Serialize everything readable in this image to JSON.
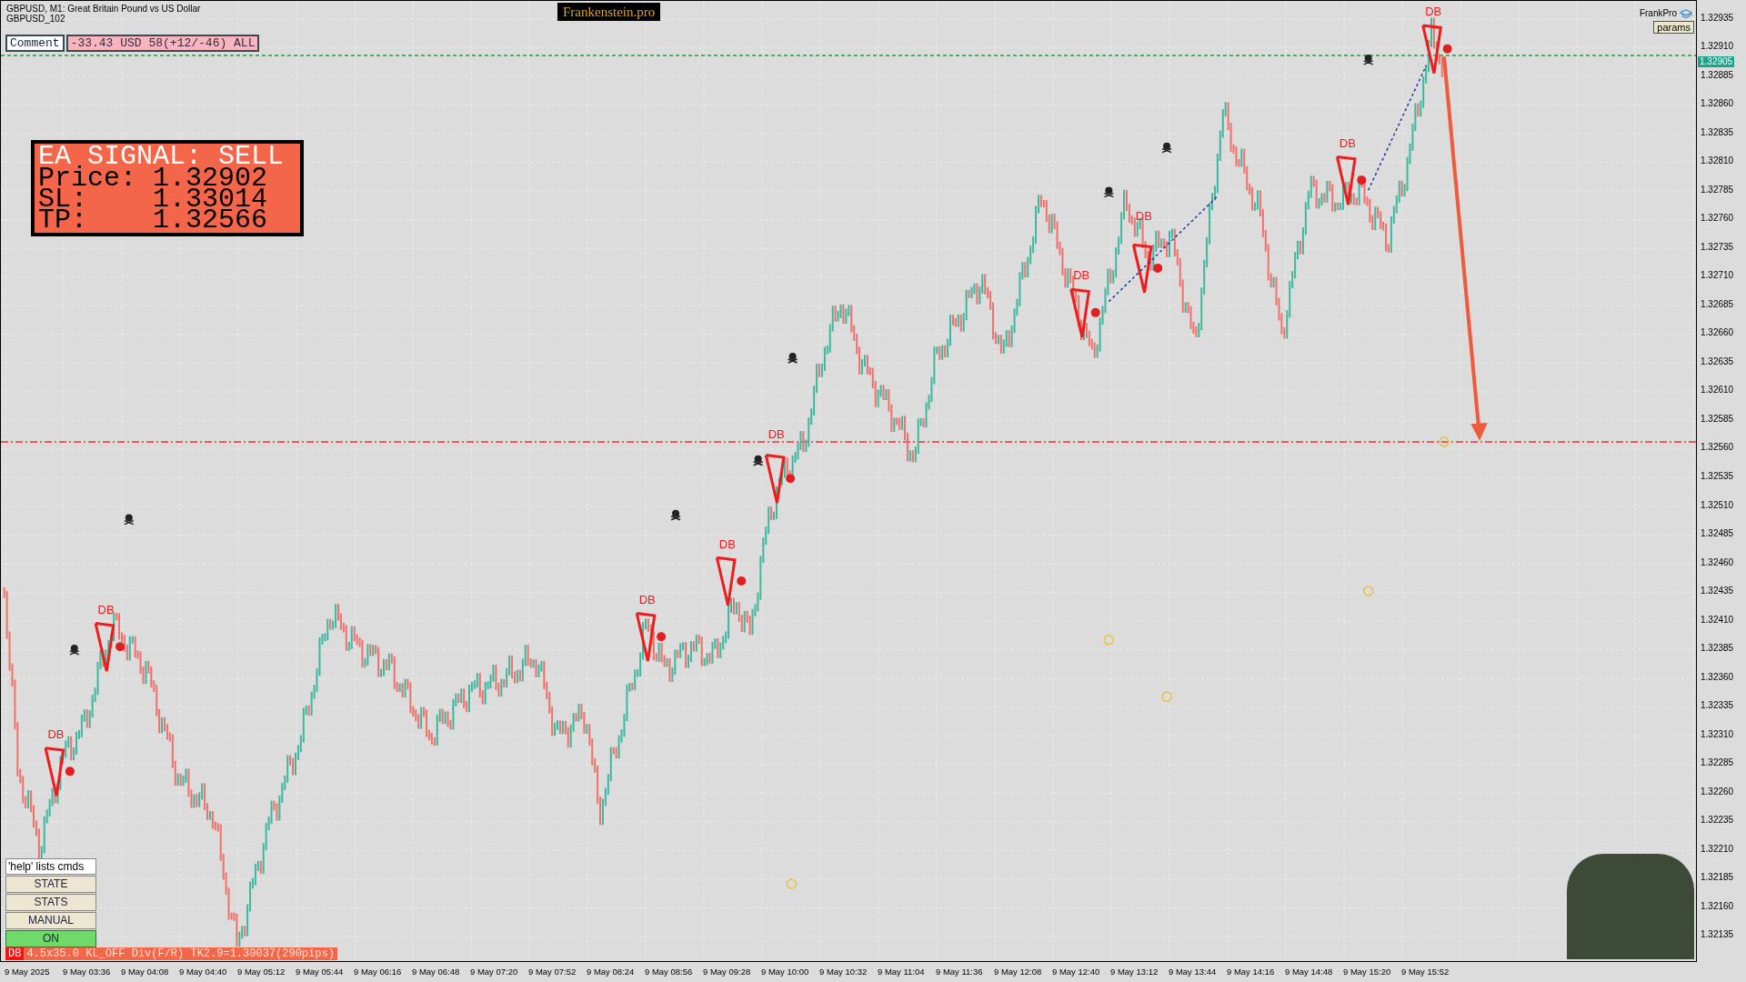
{
  "chart": {
    "symbol_line": "GBPUSD, M1:  Great Britain Pound vs US Dollar",
    "sub_line": "GBPUSD_102"
  },
  "comment": {
    "label": "Comment",
    "value": "-33.43 USD 58(+12/-46) ALL"
  },
  "brand": "Frankenstein.pro",
  "indicator": {
    "name": "FrankPro",
    "button": "params"
  },
  "signal_panel": {
    "title": "EA SIGNAL: SELL",
    "rows": [
      {
        "label": "Price:",
        "value": "1.32902"
      },
      {
        "label": "SL:",
        "value": "1.33014"
      },
      {
        "label": "TP:",
        "value": "1.32566"
      }
    ]
  },
  "pattern_labels": [
    "DB",
    "DB",
    "DB",
    "DB",
    "DB",
    "DB",
    "DB",
    "DB",
    "DB"
  ],
  "controls": {
    "hint": "'help' lists cmds",
    "buttons": [
      {
        "label": "STATE",
        "kind": "plain"
      },
      {
        "label": "STATS",
        "kind": "plain"
      },
      {
        "label": "MANUAL",
        "kind": "plain"
      },
      {
        "label": "ON",
        "kind": "toggle",
        "on": true
      }
    ]
  },
  "status_bar": {
    "tag": "DB",
    "text": "4.5x35.0 KL_OFF Div(F/R) TK2.9=1.30037(290pips)"
  },
  "price_axis": {
    "labels": [
      "1.32935",
      "1.32910",
      "1.32885",
      "1.32860",
      "1.32835",
      "1.32810",
      "1.32785",
      "1.32760",
      "1.32735",
      "1.32710",
      "1.32685",
      "1.32660",
      "1.32635",
      "1.32610",
      "1.32585",
      "1.32560",
      "1.32535",
      "1.32510",
      "1.32485",
      "1.32460",
      "1.32435",
      "1.32410",
      "1.32385",
      "1.32360",
      "1.32335",
      "1.32310",
      "1.32285",
      "1.32260",
      "1.32235",
      "1.32210",
      "1.32185",
      "1.32160",
      "1.32135"
    ],
    "current_price": "1.32905"
  },
  "time_axis": {
    "labels": [
      "9 May 2025",
      "9 May 03:36",
      "9 May 04:08",
      "9 May 04:40",
      "9 May 05:12",
      "9 May 05:44",
      "9 May 06:16",
      "9 May 06:48",
      "9 May 07:20",
      "9 May 07:52",
      "9 May 08:24",
      "9 May 08:56",
      "9 May 09:28",
      "9 May 10:00",
      "9 May 10:32",
      "9 May 11:04",
      "9 May 11:36",
      "9 May 12:08",
      "9 May 12:40",
      "9 May 13:12",
      "9 May 13:44",
      "9 May 14:16",
      "9 May 14:48",
      "9 May 15:20",
      "9 May 15:52"
    ]
  }
}
